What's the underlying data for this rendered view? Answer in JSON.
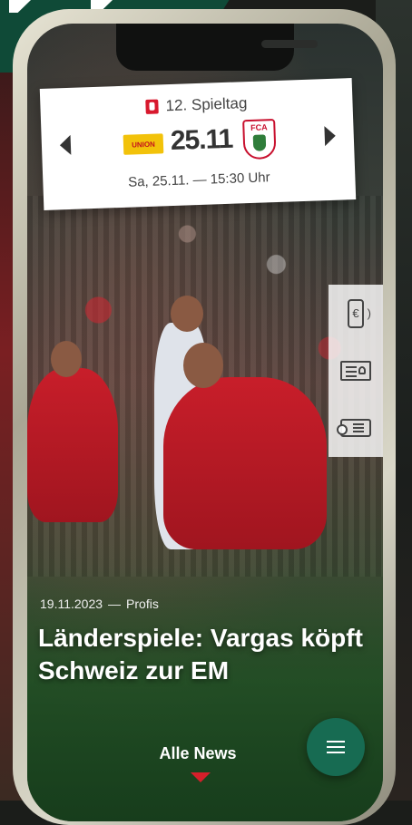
{
  "match": {
    "matchday": "12. Spieltag",
    "home_team_logo_text": "UNION",
    "score": "25.11",
    "away_team_logo_text": "FCA",
    "datetime": "Sa, 25.11. — 15:30 Uhr"
  },
  "news": {
    "date": "19.11.2023",
    "separator": "—",
    "category": "Profis",
    "headline": "Länderspiele: Vargas köpft Schweiz zur EM"
  },
  "footer": {
    "all_news_label": "Alle News"
  },
  "colors": {
    "accent_green": "#176b52",
    "accent_red": "#d51f2a"
  },
  "icons": [
    "league-icon",
    "prev-arrow-icon",
    "next-arrow-icon",
    "payment-phone-icon",
    "id-card-icon",
    "ticket-icon",
    "menu-icon",
    "caret-down-icon"
  ]
}
